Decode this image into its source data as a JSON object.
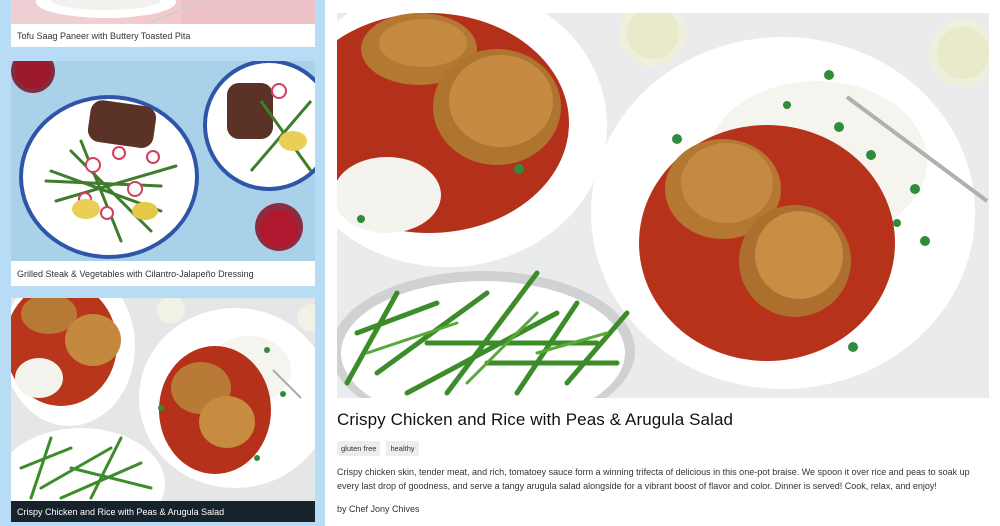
{
  "recipes": [
    {
      "title": "Tofu Saag Paneer with Buttery Toasted Pita"
    },
    {
      "title": "Grilled Steak & Vegetables with Cilantro-Jalapeño Dressing"
    },
    {
      "title": "Crispy Chicken and Rice with Peas & Arugula Salad"
    }
  ],
  "detail": {
    "title": "Crispy Chicken and Rice with Peas & Arugula Salad",
    "tags": [
      "gluten free",
      "healthy"
    ],
    "description": "Crispy chicken skin, tender meat, and rich, tomatoey sauce form a winning trifecta of delicious in this one-pot braise. We spoon it over rice and peas to soak up every last drop of goodness, and serve a tangy arugula salad alongside for a vibrant boost of flavor and color. Dinner is served! Cook, relax, and enjoy!",
    "author": "by Chef Jony Chives"
  },
  "colors": {
    "sidebar_bg": "#b9dcf6",
    "selected_caption_bg": "#17232b"
  }
}
